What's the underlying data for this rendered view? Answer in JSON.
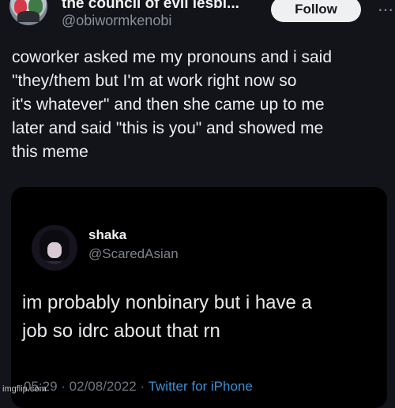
{
  "tweet": {
    "display_name": "the council of evil lesbi...",
    "handle": "@obiwormkenobi",
    "follow_label": "Follow",
    "more_icon": "more-icon",
    "text": "coworker asked me my pronouns and i said\n\"they/them but I'm at work right now so\nit's whatever\" and then she came up to me\nlater and said \"this is you\" and showed me\nthis meme"
  },
  "quoted": {
    "name": "shaka",
    "handle": "@ScaredAsian",
    "text": "im probably nonbinary but i have a\njob so idrc about that rn",
    "time": "05:29",
    "separator": " · ",
    "date": "02/08/2022",
    "source": "Twitter for iPhone"
  },
  "watermark": "imgflip.com",
  "colors": {
    "background": "#121419",
    "card": "#000000",
    "follow_bg": "#eef0f2",
    "link": "#3b8fd6",
    "muted": "#8b919a"
  }
}
